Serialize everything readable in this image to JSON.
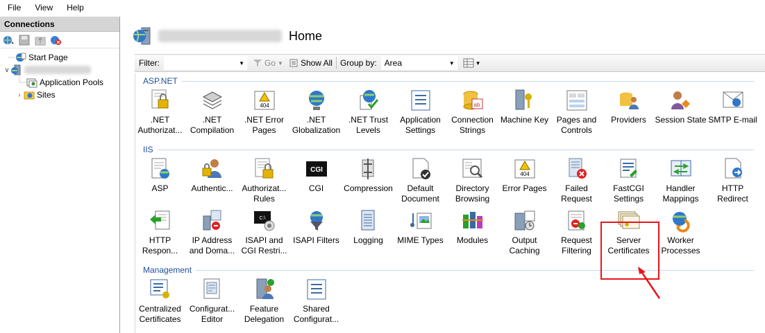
{
  "menu": {
    "file": "File",
    "view": "View",
    "help": "Help"
  },
  "connections": {
    "header": "Connections",
    "tree": {
      "start_page": "Start Page",
      "app_pools": "Application Pools",
      "sites": "Sites"
    }
  },
  "page": {
    "title": "Home"
  },
  "filter": {
    "filter_label": "Filter:",
    "go_label": "Go",
    "show_all_label": "Show All",
    "group_by_label": "Group by:",
    "group_by_value": "Area"
  },
  "groups": {
    "aspnet": "ASP.NET",
    "iis": "IIS",
    "management": "Management"
  },
  "aspnet_items": [
    {
      "label": ".NET Authorizat...",
      "icon": "lock-document-icon"
    },
    {
      "label": ".NET Compilation",
      "icon": "compile-stack-icon"
    },
    {
      "label": ".NET Error Pages",
      "icon": "error-404-icon"
    },
    {
      "label": ".NET Globalization",
      "icon": "globe-icon"
    },
    {
      "label": ".NET Trust Levels",
      "icon": "trust-check-icon"
    },
    {
      "label": "Application Settings",
      "icon": "settings-list-icon"
    },
    {
      "label": "Connection Strings",
      "icon": "database-ab-icon"
    },
    {
      "label": "Machine Key",
      "icon": "machine-key-icon"
    },
    {
      "label": "Pages and Controls",
      "icon": "pages-controls-icon"
    },
    {
      "label": "Providers",
      "icon": "providers-icon"
    },
    {
      "label": "Session State",
      "icon": "session-state-icon"
    },
    {
      "label": "SMTP E-mail",
      "icon": "smtp-email-icon"
    }
  ],
  "iis_row1": [
    {
      "label": "ASP",
      "icon": "asp-icon"
    },
    {
      "label": "Authentic...",
      "icon": "authentication-icon"
    },
    {
      "label": "Authorizat... Rules",
      "icon": "authorization-rules-icon"
    },
    {
      "label": "CGI",
      "icon": "cgi-icon"
    },
    {
      "label": "Compression",
      "icon": "compression-icon"
    },
    {
      "label": "Default Document",
      "icon": "default-document-icon"
    },
    {
      "label": "Directory Browsing",
      "icon": "directory-browsing-icon"
    },
    {
      "label": "Error Pages",
      "icon": "error-pages-icon"
    },
    {
      "label": "Failed Request Tra...",
      "icon": "failed-request-icon"
    },
    {
      "label": "FastCGI Settings",
      "icon": "fastcgi-icon"
    },
    {
      "label": "Handler Mappings",
      "icon": "handler-mappings-icon"
    },
    {
      "label": "HTTP Redirect",
      "icon": "http-redirect-icon"
    }
  ],
  "iis_row2": [
    {
      "label": "HTTP Respon...",
      "icon": "http-response-icon"
    },
    {
      "label": "IP Address and Doma...",
      "icon": "ip-address-icon"
    },
    {
      "label": "ISAPI and CGI Restri...",
      "icon": "isapi-cgi-icon"
    },
    {
      "label": "ISAPI Filters",
      "icon": "isapi-filters-icon"
    },
    {
      "label": "Logging",
      "icon": "logging-icon"
    },
    {
      "label": "MIME Types",
      "icon": "mime-types-icon"
    },
    {
      "label": "Modules",
      "icon": "modules-icon"
    },
    {
      "label": "Output Caching",
      "icon": "output-caching-icon"
    },
    {
      "label": "Request Filtering",
      "icon": "request-filtering-icon"
    },
    {
      "label": "Server Certificates",
      "icon": "server-certificates-icon"
    },
    {
      "label": "Worker Processes",
      "icon": "worker-processes-icon"
    }
  ],
  "management_items": [
    {
      "label": "Centralized Certificates",
      "icon": "centralized-certificates-icon"
    },
    {
      "label": "Configurat... Editor",
      "icon": "configuration-editor-icon"
    },
    {
      "label": "Feature Delegation",
      "icon": "feature-delegation-icon"
    },
    {
      "label": "Shared Configurat...",
      "icon": "shared-configuration-icon"
    }
  ],
  "colors": {
    "highlight": "#e8141a",
    "group_header": "#1f4e9c",
    "pane_header": "#d5d5d5"
  }
}
